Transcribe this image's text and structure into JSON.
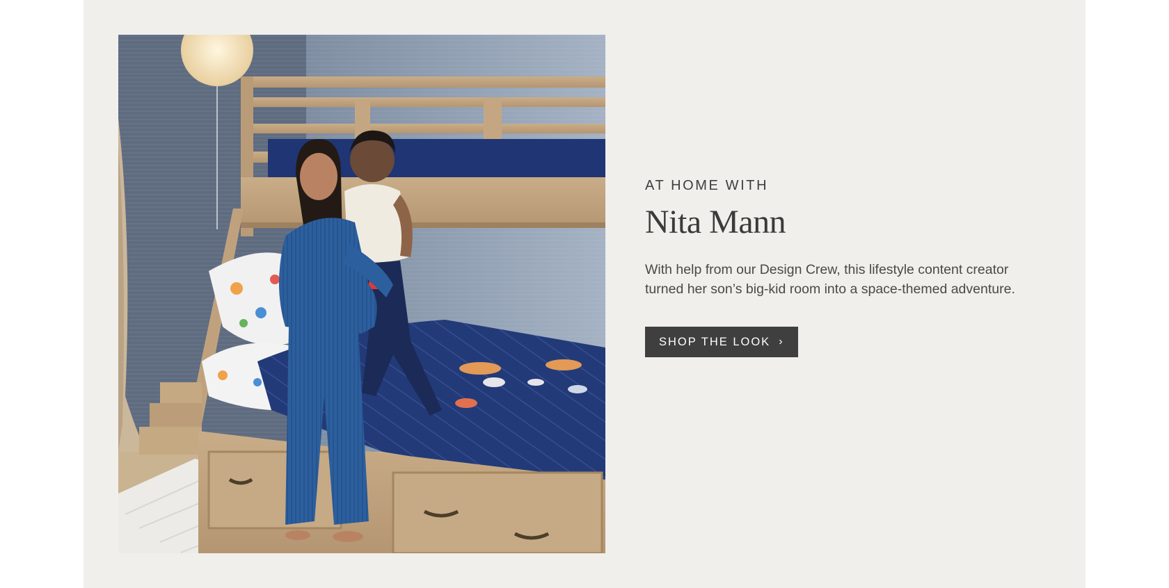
{
  "feature": {
    "eyebrow": "AT HOME WITH",
    "name": "Nita Mann",
    "description": "With help from our Design Crew, this lifestyle content creator turned her son’s big-kid room into a space-themed adventure.",
    "cta_label": "SHOP THE LOOK",
    "cta_icon": "chevron-right-icon"
  },
  "image": {
    "subject": "mother-and-son-bunk-bed-photo"
  },
  "colors": {
    "panel_bg": "#f0efec",
    "button_bg": "#3f3f3f",
    "heading_text": "#3b3a38"
  }
}
